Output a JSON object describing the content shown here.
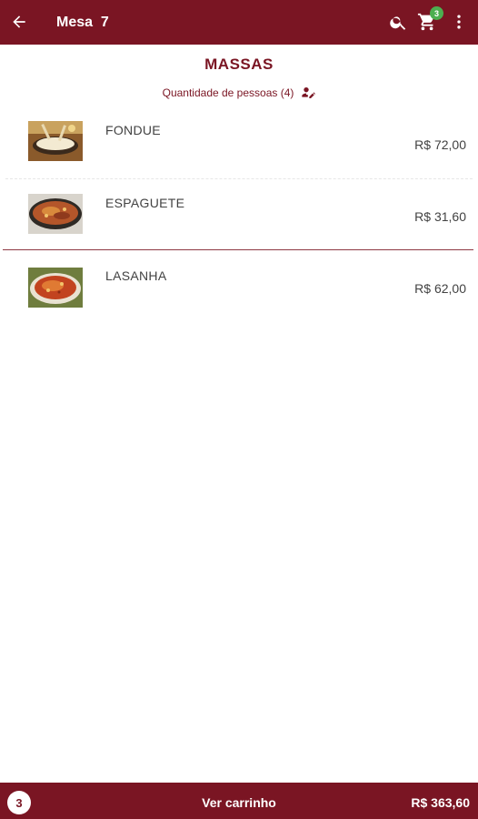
{
  "appbar": {
    "title": "Mesa  7",
    "cart_count": "3",
    "icons": [
      "arrow-back-icon",
      "search-icon",
      "cart-icon",
      "more-vert-icon"
    ]
  },
  "category": {
    "title": "MASSAS",
    "people_label": "Quantidade de pessoas (4)"
  },
  "items": [
    {
      "name": "FONDUE",
      "price": "R$ 72,00"
    },
    {
      "name": "ESPAGUETE",
      "price": "R$ 31,60"
    },
    {
      "name": "LASANHA",
      "price": "R$ 62,00"
    }
  ],
  "bottombar": {
    "count": "3",
    "view_cart_label": "Ver carrinho",
    "total": "R$ 363,60"
  },
  "colors": {
    "primary": "#7a1523",
    "badge": "#4caf50",
    "text": "#424242"
  }
}
